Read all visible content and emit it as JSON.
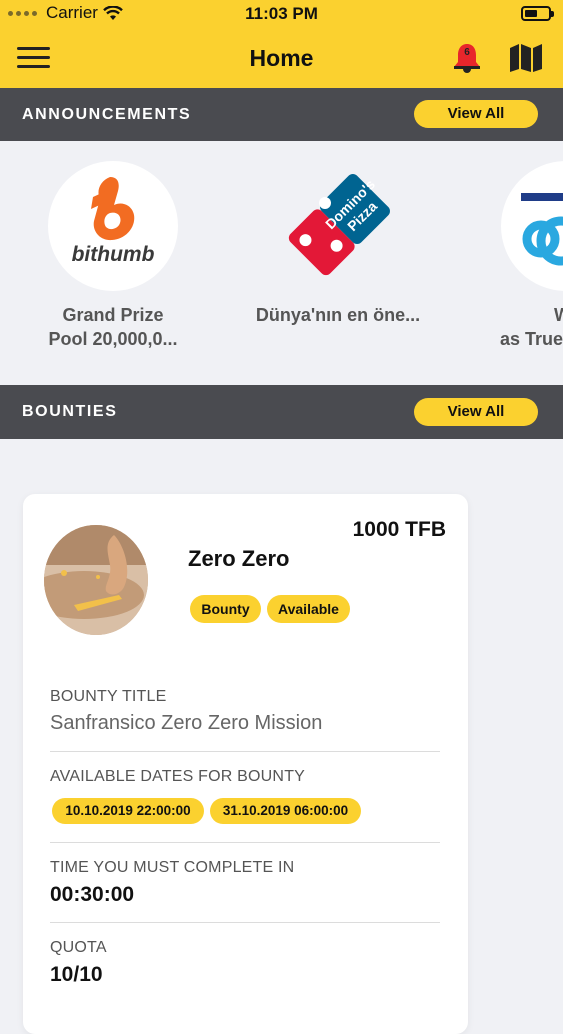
{
  "status_bar": {
    "carrier": "Carrier",
    "time": "11:03 PM"
  },
  "navbar": {
    "title": "Home",
    "notification_count": "6"
  },
  "announcements": {
    "header": "ANNOUNCEMENTS",
    "view_all_label": "View All",
    "items": [
      {
        "brand": "bithumb",
        "text_line1": "Grand Prize",
        "text_line2": "Pool 20,000,0..."
      },
      {
        "brand_line1": "Domino's",
        "brand_line2": "Pizza",
        "text_line1": "Dünya'nın en öne...",
        "text_line2": ""
      },
      {
        "text_line1": "W",
        "text_line2": "as TrueB"
      }
    ]
  },
  "bounties": {
    "header": "BOUNTIES",
    "view_all_label": "View All",
    "card": {
      "name": "Zero Zero",
      "reward": "1000 TFB",
      "tags": [
        "Bounty",
        "Available"
      ],
      "bounty_title_label": "BOUNTY TITLE",
      "bounty_title_value": "Sanfransico Zero Zero Mission",
      "dates_label": "AVAILABLE DATES FOR BOUNTY",
      "dates": [
        "10.10.2019 22:00:00",
        "31.10.2019 06:00:00"
      ],
      "time_label": "TIME YOU MUST COMPLETE IN",
      "time_value": "00:30:00",
      "quota_label": "QUOTA",
      "quota_value": "10/10"
    }
  },
  "colors": {
    "accent": "#fbd12f",
    "section_header": "#4a4b50",
    "background": "#f0f1f5",
    "badge_red": "#e8262b"
  }
}
